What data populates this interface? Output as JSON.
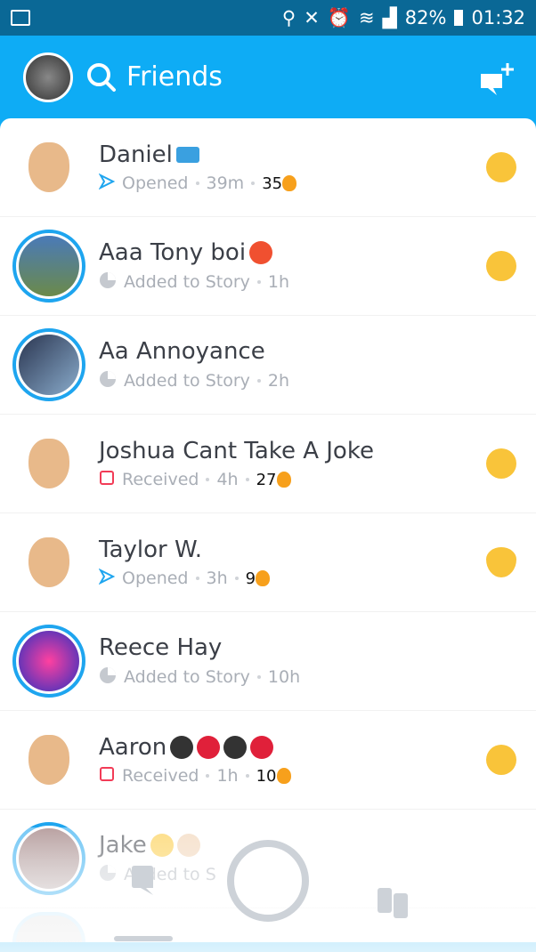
{
  "status_bar": {
    "battery": "82%",
    "time": "01:32"
  },
  "header": {
    "title": "Friends"
  },
  "friends": [
    {
      "name": "Daniel",
      "name_emojis": [
        "credit-card"
      ],
      "status": "Opened",
      "status_icon": "opened-arrow",
      "time": "39m",
      "streak": "35",
      "friend_emoji": "heart-eyes",
      "story": false
    },
    {
      "name": "Aaa Tony boi",
      "name_emojis": [
        "smiling-devil"
      ],
      "status": "Added to Story",
      "status_icon": "story-pie",
      "time": "1h",
      "streak": null,
      "friend_emoji": "smirk",
      "story": true
    },
    {
      "name": "Aa Annoyance",
      "name_emojis": [],
      "status": "Added to Story",
      "status_icon": "story-pie",
      "time": "2h",
      "streak": null,
      "friend_emoji": null,
      "story": true
    },
    {
      "name": "Joshua Cant Take A Joke",
      "name_emojis": [],
      "status": "Received",
      "status_icon": "received-square",
      "time": "4h",
      "streak": "27",
      "friend_emoji": "heart-eyes",
      "story": false
    },
    {
      "name": "Taylor W.",
      "name_emojis": [],
      "status": "Opened",
      "status_icon": "opened-arrow",
      "time": "3h",
      "streak": "9",
      "friend_emoji": "yellow-heart",
      "story": false
    },
    {
      "name": "Reece Hay",
      "name_emojis": [],
      "status": "Added to Story",
      "status_icon": "story-pie",
      "time": "10h",
      "streak": null,
      "friend_emoji": null,
      "story": true
    },
    {
      "name": "Aaron",
      "name_emojis": [
        "club",
        "heart",
        "spade",
        "diamond"
      ],
      "status": "Received",
      "status_icon": "received-square",
      "time": "1h",
      "streak": "10",
      "friend_emoji": "heart-eyes",
      "story": false
    },
    {
      "name": "Jake",
      "name_emojis": [
        "relieved-face",
        "call-me-hand"
      ],
      "status": "Added to S",
      "status_icon": "story-pie",
      "time": null,
      "streak": null,
      "friend_emoji": null,
      "story": true
    }
  ],
  "colors": {
    "header": "#0eacf5",
    "status_bar": "#0a6896",
    "opened": "#1ea5ef",
    "received": "#f23c57",
    "story_ring": "#1ea5ef"
  }
}
